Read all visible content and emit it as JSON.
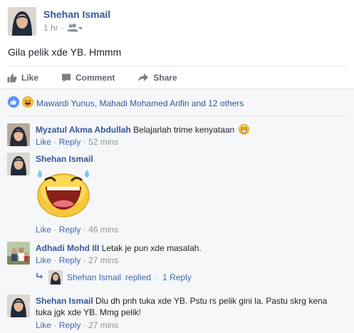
{
  "post": {
    "author": "Shehan Ismail",
    "time": "1 hr",
    "privacy_icon": "friends-icon",
    "text": "Gila pelik xde YB. Hmmm"
  },
  "actions": {
    "like": "Like",
    "comment": "Comment",
    "share": "Share"
  },
  "reactions": {
    "icons": [
      "like-reaction-icon",
      "haha-reaction-icon"
    ],
    "text": "Mawardi Yunus, Mahadi Mohamed Arifin and 12 others"
  },
  "comments": [
    {
      "author": "Myzatul Akma Abdullah",
      "text": "Belajarlah trime kenyataan",
      "emoji": "laughing-emoji-icon",
      "like": "Like",
      "reply": "Reply",
      "time": "52 mins"
    },
    {
      "author": "Shehan Ismail",
      "text": "",
      "sticker": "laughing-sticker",
      "like": "Like",
      "reply": "Reply",
      "time": "46 mins"
    },
    {
      "author": "Adhadi Mohd III",
      "text": "Letak je pun xde masalah.",
      "like": "Like",
      "reply": "Reply",
      "time": "27 mins"
    },
    {
      "author": "Shehan Ismail",
      "text": "Dlu dh pnh tuka xde YB. Pstu rs pelik gini la. Pastu skrg kena",
      "text_line2": "tuka jgk xde YB. Mmg pelik!",
      "like": "Like",
      "reply": "Reply",
      "time": "27 mins"
    }
  ],
  "reply_summary": {
    "author": "Shehan Ismail",
    "replied": "replied",
    "count": "1 Reply"
  },
  "sep": "·",
  "colors": {
    "link": "#365899",
    "accent": "#4267b2",
    "muted": "#90949c",
    "background": "#f6f7f9"
  }
}
